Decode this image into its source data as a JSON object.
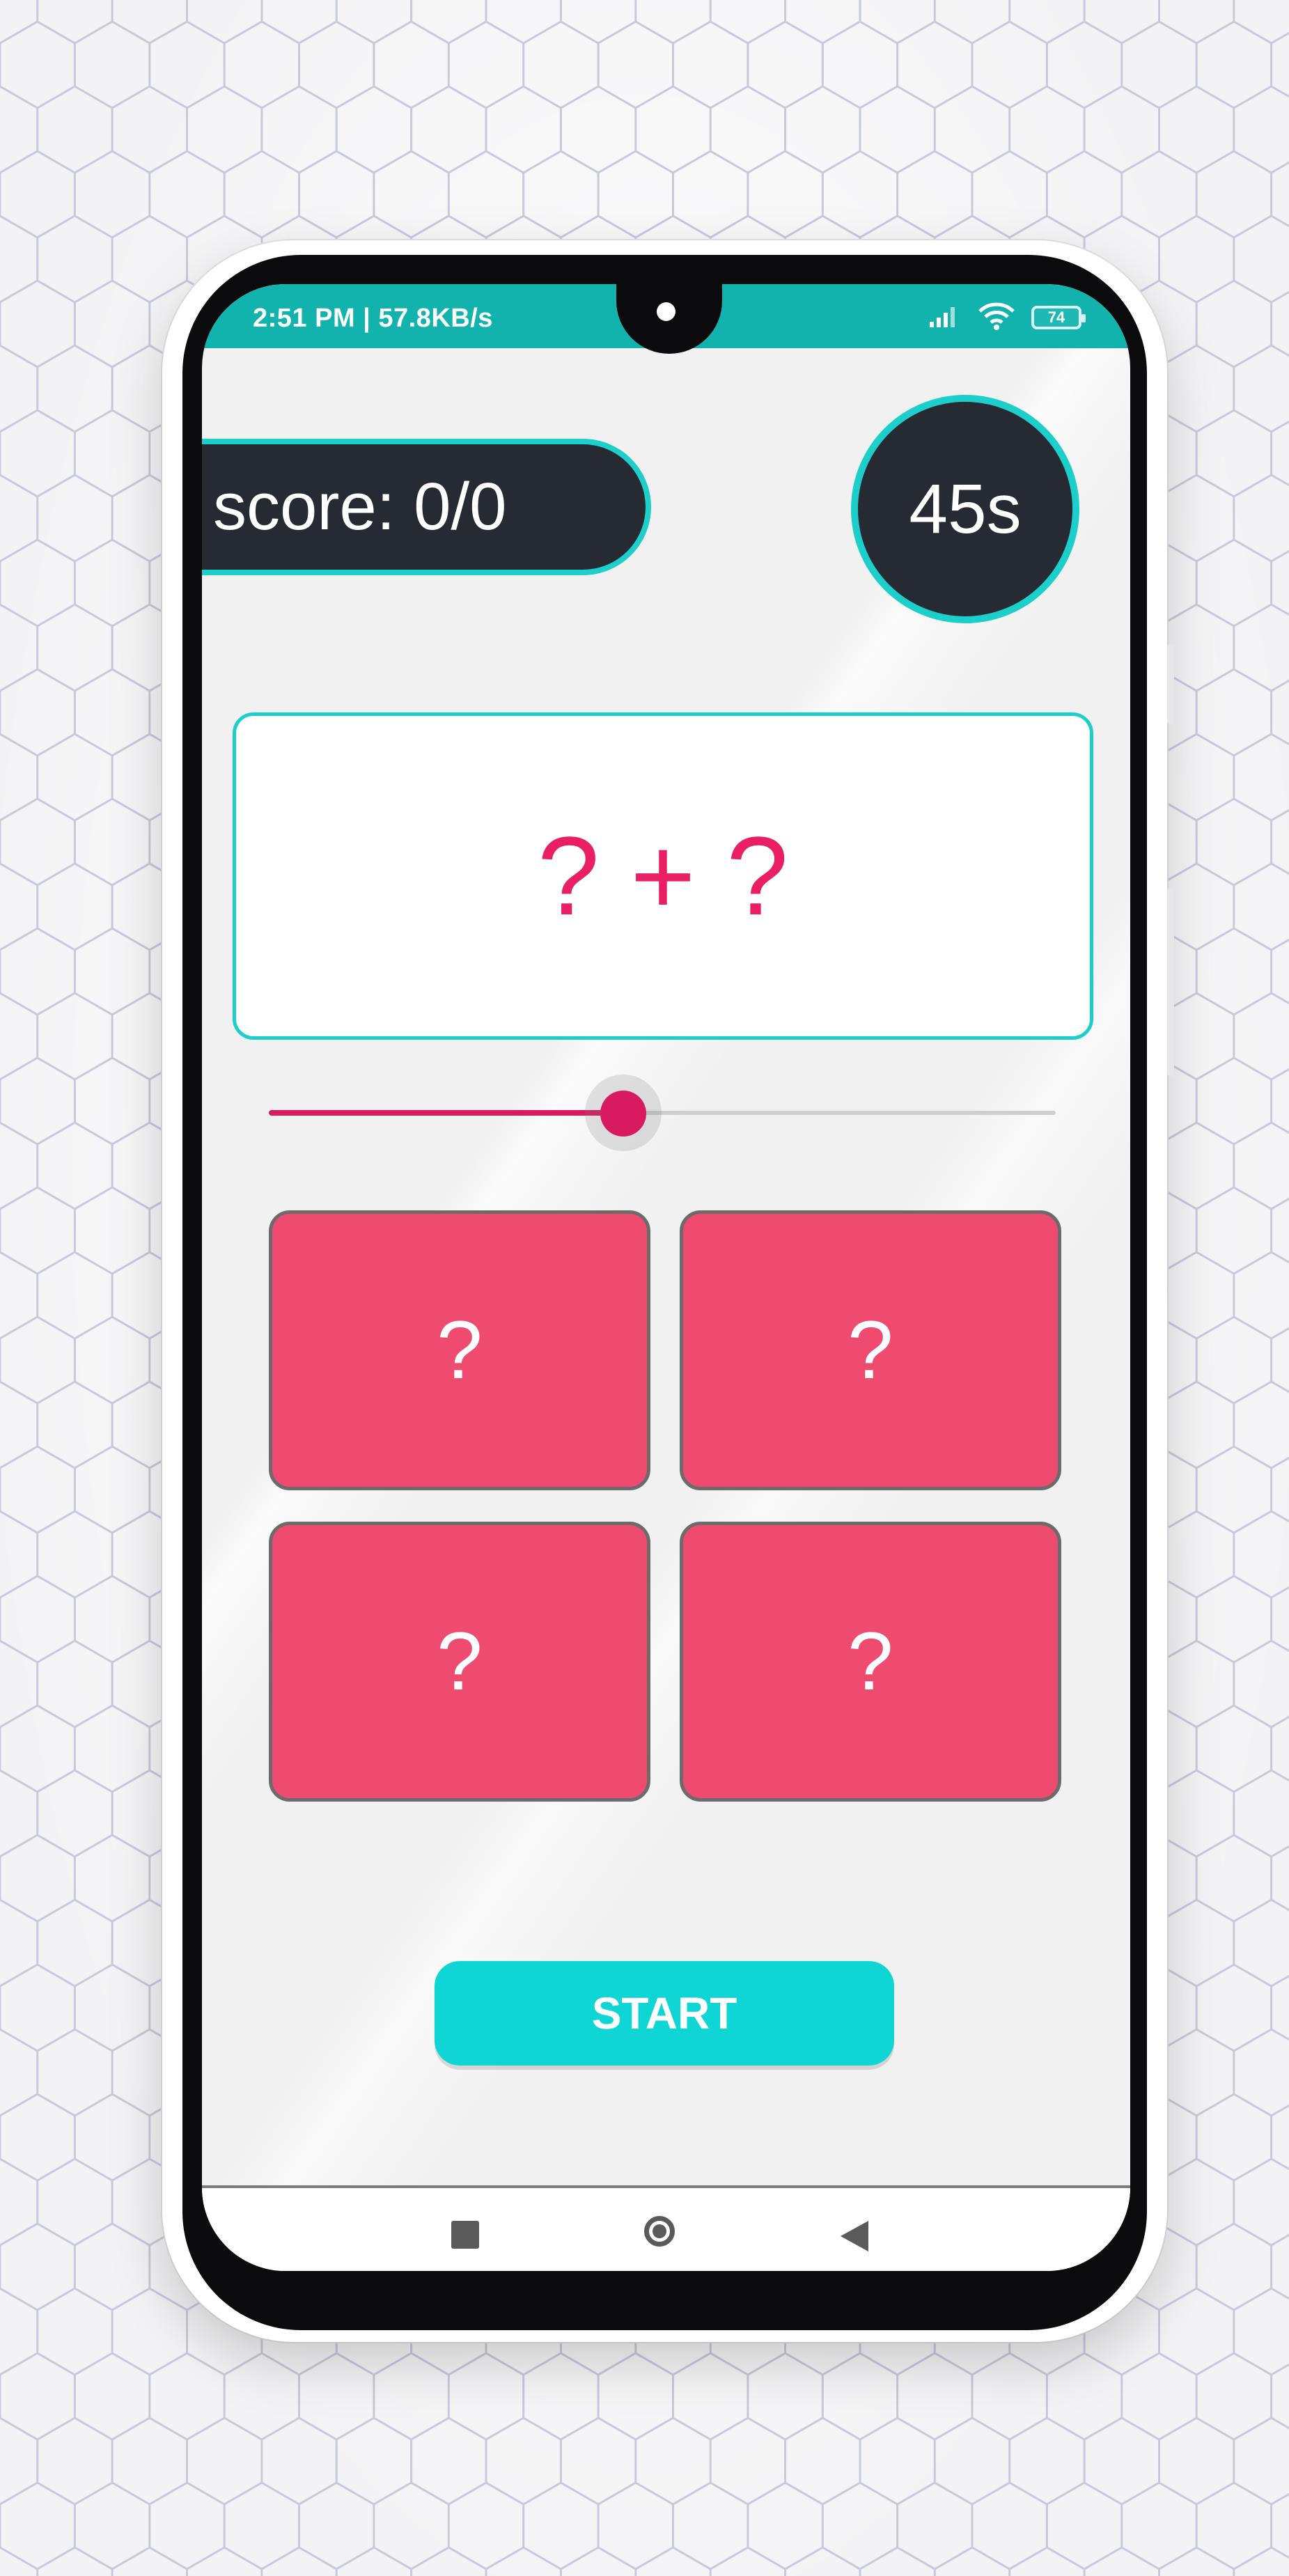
{
  "status_bar": {
    "time": "2:51 PM | 57.8KB/s",
    "battery": "74",
    "icons": [
      "signal-icon",
      "wifi-icon",
      "battery-icon"
    ]
  },
  "game": {
    "score": "score: 0/0",
    "timer": "45s",
    "question": "? + ?",
    "slider_value_fraction": 0.45,
    "answers": [
      "?",
      "?",
      "?",
      "?"
    ],
    "start_label": "START"
  },
  "nav_bar": {
    "icons": [
      "recents-icon",
      "home-icon",
      "back-icon"
    ]
  },
  "colors": {
    "status_bar": "#13b3ad",
    "accent_cyan": "#1ccfcb",
    "dark_panel": "#262a33",
    "question_text": "#e91e63",
    "answer_button": "#ef4b71",
    "slider": "#d81b60",
    "start_button": "#0fd6d4"
  }
}
